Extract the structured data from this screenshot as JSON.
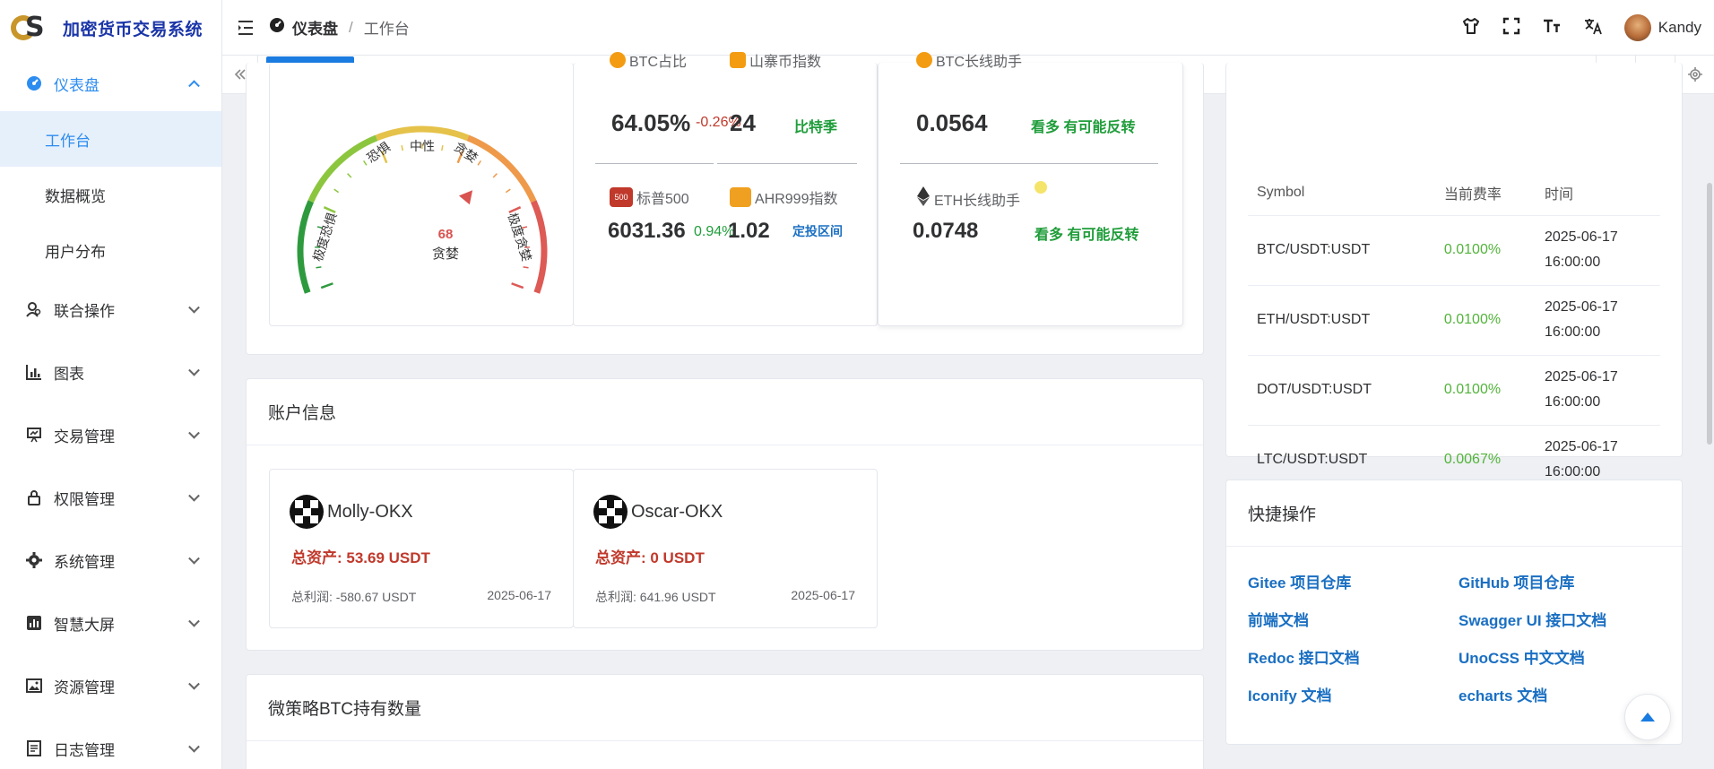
{
  "app": {
    "title": "加密货币交易系统",
    "logo_letters": "S"
  },
  "breadcrumb": {
    "section": "仪表盘",
    "page": "工作台"
  },
  "user": {
    "name": "Kandy"
  },
  "tabs": [
    {
      "label": "工作台",
      "active": true
    }
  ],
  "sidebar": {
    "items": [
      {
        "label": "仪表盘",
        "expanded": true,
        "children": [
          {
            "label": "工作台",
            "active": true
          },
          {
            "label": "数据概览"
          },
          {
            "label": "用户分布"
          }
        ]
      },
      {
        "label": "联合操作"
      },
      {
        "label": "图表"
      },
      {
        "label": "交易管理"
      },
      {
        "label": "权限管理"
      },
      {
        "label": "系统管理"
      },
      {
        "label": "智慧大屏"
      },
      {
        "label": "资源管理"
      },
      {
        "label": "日志管理"
      }
    ]
  },
  "gauge": {
    "labels": [
      "极度恐惧",
      "恐惧",
      "中性",
      "贪婪",
      "极度贪婪"
    ],
    "value": "68",
    "status": "贪婪",
    "min": 0,
    "max": 100,
    "reading": 68
  },
  "indicators": {
    "btc_dominance": {
      "label": "BTC占比",
      "value": "64.05%",
      "change": "-0.26%"
    },
    "altseason": {
      "label": "山寨币指数",
      "value": "24",
      "tag": "比特季"
    },
    "sp500": {
      "label": "标普500",
      "badge": "500",
      "value": "6031.36",
      "change": "0.94%"
    },
    "ahr999": {
      "label": "AHR999指数",
      "value": "1.02",
      "tag": "定投区间"
    },
    "btc_long": {
      "label": "BTC长线助手",
      "value": "0.0564",
      "tag": "看多 有可能反转"
    },
    "eth_long": {
      "label": "ETH长线助手",
      "value": "0.0748",
      "tag": "看多 有可能反转"
    }
  },
  "accounts": {
    "title": "账户信息",
    "items": [
      {
        "name": "Molly-OKX",
        "total": "总资产: 53.69 USDT",
        "profit": "总利润: -580.67 USDT",
        "date": "2025-06-17"
      },
      {
        "name": "Oscar-OKX",
        "total": "总资产: 0 USDT",
        "profit": "总利润: 641.96 USDT",
        "date": "2025-06-17"
      }
    ]
  },
  "strategy": {
    "title": "微策略BTC持有数量"
  },
  "funding": {
    "headers": [
      "Symbol",
      "当前费率",
      "时间"
    ],
    "rows": [
      {
        "symbol": "BTC/USDT:USDT",
        "rate": "0.0100%",
        "date": "2025-06-17",
        "time": "16:00:00"
      },
      {
        "symbol": "ETH/USDT:USDT",
        "rate": "0.0100%",
        "date": "2025-06-17",
        "time": "16:00:00"
      },
      {
        "symbol": "DOT/USDT:USDT",
        "rate": "0.0100%",
        "date": "2025-06-17",
        "time": "16:00:00"
      },
      {
        "symbol": "LTC/USDT:USDT",
        "rate": "0.0067%",
        "date": "2025-06-17",
        "time": "16:00:00"
      }
    ]
  },
  "quick": {
    "title": "快捷操作",
    "links": [
      "Gitee 项目仓库",
      "GitHub 项目仓库",
      "前端文档",
      "Swagger UI 接口文档",
      "Redoc 接口文档",
      "UnoCSS 中文文档",
      "Iconify 文档",
      "echarts 文档"
    ]
  },
  "colors": {
    "accent": "#1a7be0",
    "gain": "#1f9d3a",
    "loss": "#c0392b",
    "brand": "#1a35a8"
  }
}
